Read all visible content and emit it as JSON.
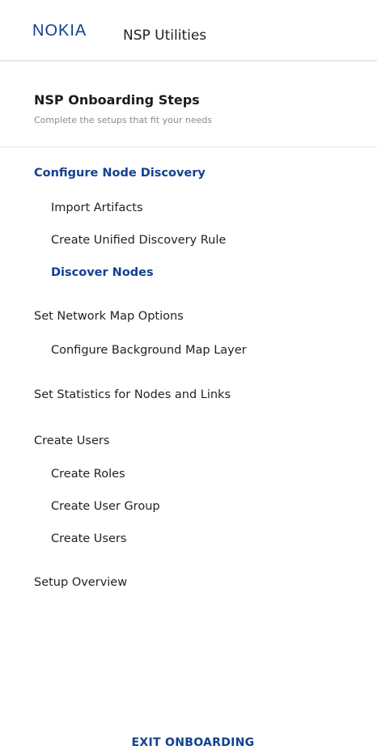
{
  "header": {
    "logo_text": "NOKIA",
    "app_title": "NSP Utilities",
    "brand_color": "#124191"
  },
  "onboarding": {
    "title": "NSP Onboarding Steps",
    "subtitle": "Complete the setups that fit your needs"
  },
  "nav": {
    "items": [
      {
        "label": "Configure Node Discovery",
        "level": 0,
        "active": true
      },
      {
        "label": "Import Artifacts",
        "level": 1,
        "active": false
      },
      {
        "label": "Create Unified Discovery Rule",
        "level": 1,
        "active": false
      },
      {
        "label": "Discover Nodes",
        "level": 1,
        "active": true
      },
      {
        "label": "Set Network Map Options",
        "level": 0,
        "active": false
      },
      {
        "label": "Configure Background Map Layer",
        "level": 1,
        "active": false
      },
      {
        "label": "Set Statistics for Nodes and Links",
        "level": 0,
        "active": false
      },
      {
        "label": "Create Users",
        "level": 0,
        "active": false
      },
      {
        "label": "Create Roles",
        "level": 1,
        "active": false
      },
      {
        "label": "Create User Group",
        "level": 1,
        "active": false
      },
      {
        "label": "Create Users",
        "level": 1,
        "active": false
      },
      {
        "label": "Setup Overview",
        "level": 0,
        "active": false
      }
    ]
  },
  "footer": {
    "exit_label": "EXIT ONBOARDING"
  }
}
